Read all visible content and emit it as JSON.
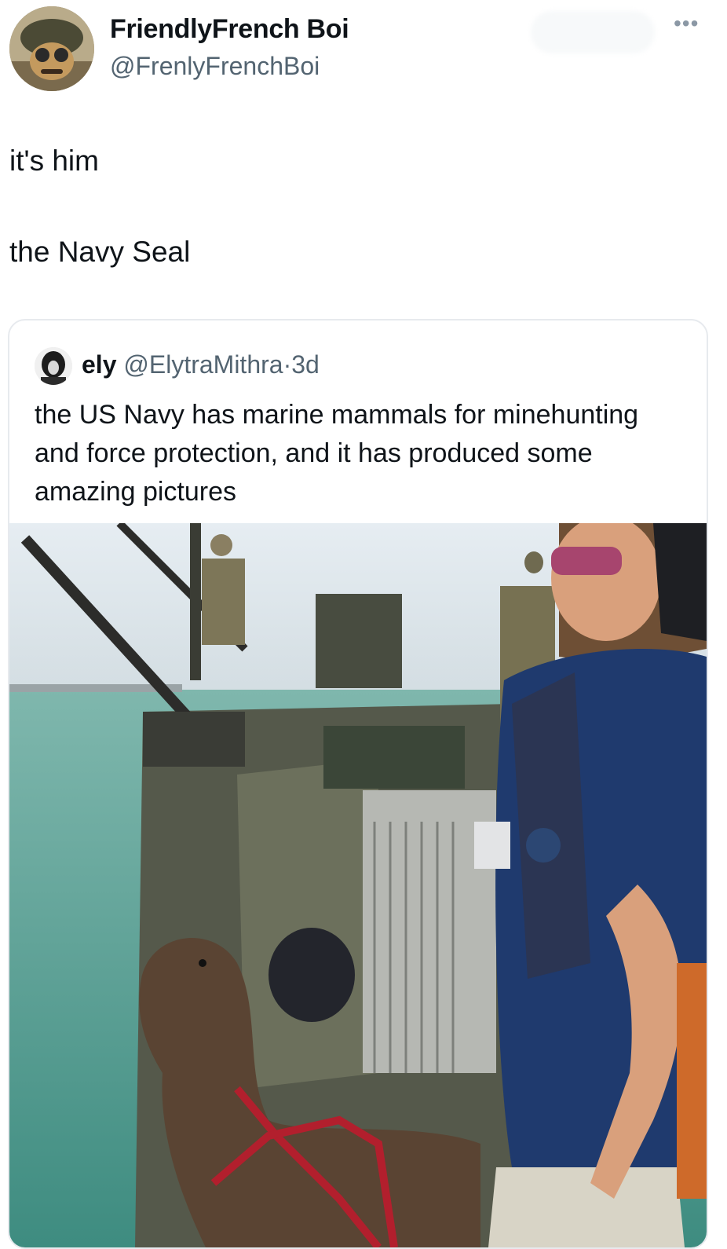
{
  "tweet": {
    "author_name": "FriendlyFrench Boi",
    "author_handle": "@FrenlyFrenchBoi",
    "more_icon": "more-horizontal-icon",
    "text_line_1": "it's him",
    "text_line_2": "the Navy Seal"
  },
  "quoted_tweet": {
    "author_name": "ely",
    "author_handle": "@ElytraMithra",
    "separator": "·",
    "time": "3d",
    "body": "the US Navy has marine mammals for minehunting and force protection, and it has produced some amazing pictures"
  },
  "colors": {
    "text_primary": "#0f1419",
    "text_secondary": "#536471",
    "border": "#e7eaee"
  }
}
